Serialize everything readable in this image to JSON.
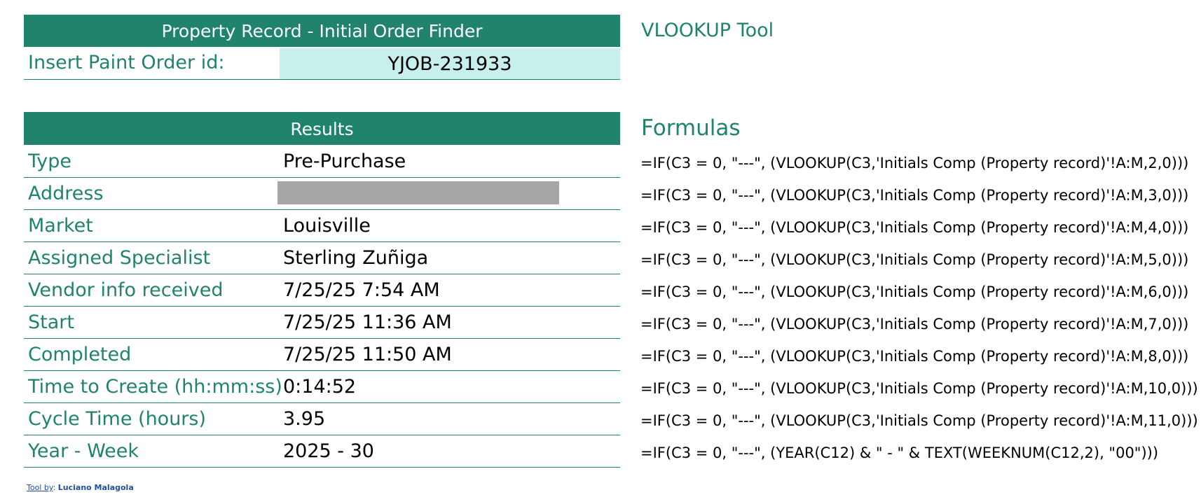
{
  "tool": {
    "title": "Property Record - Initial Order Finder",
    "input_label": "Insert Paint Order id:",
    "input_value": "YJOB-231933",
    "results_header": "Results"
  },
  "results": [
    {
      "label": "Type",
      "value": "Pre-Purchase",
      "redacted": false
    },
    {
      "label": "Address",
      "value": "",
      "redacted": true
    },
    {
      "label": "Market",
      "value": "Louisville",
      "redacted": false
    },
    {
      "label": "Assigned Specialist",
      "value": "Sterling Zuñiga",
      "redacted": false
    },
    {
      "label": "Vendor info received",
      "value": "7/25/25 7:54 AM",
      "redacted": false
    },
    {
      "label": "Start",
      "value": "7/25/25 11:36 AM",
      "redacted": false
    },
    {
      "label": "Completed",
      "value": "7/25/25 11:50 AM",
      "redacted": false
    },
    {
      "label": "Time to Create (hh:mm:ss)",
      "value": "0:14:52",
      "redacted": false
    },
    {
      "label": "Cycle Time (hours)",
      "value": "3.95",
      "redacted": false
    },
    {
      "label": "Year - Week",
      "value": "2025 - 30",
      "redacted": false
    }
  ],
  "side": {
    "vlookup_title": "VLOOKUP Tool",
    "formulas_title": "Formulas",
    "formulas": [
      "=IF(C3 = 0, \"---\", (VLOOKUP(C3,'Initials Comp (Property record)'!A:M,2,0)))",
      "=IF(C3 = 0, \"---\", (VLOOKUP(C3,'Initials Comp (Property record)'!A:M,3,0)))",
      "=IF(C3 = 0, \"---\", (VLOOKUP(C3,'Initials Comp (Property record)'!A:M,4,0)))",
      "=IF(C3 = 0, \"---\", (VLOOKUP(C3,'Initials Comp (Property record)'!A:M,5,0)))",
      "=IF(C3 = 0, \"---\", (VLOOKUP(C3,'Initials Comp (Property record)'!A:M,6,0)))",
      "=IF(C3 = 0, \"---\", (VLOOKUP(C3,'Initials Comp (Property record)'!A:M,7,0)))",
      "=IF(C3 = 0, \"---\", (VLOOKUP(C3,'Initials Comp (Property record)'!A:M,8,0)))",
      "=IF(C3 = 0, \"---\", (VLOOKUP(C3,'Initials Comp (Property record)'!A:M,10,0)))",
      "=IF(C3 = 0, \"---\", (VLOOKUP(C3,'Initials Comp (Property record)'!A:M,11,0)))",
      "=IF(C3 = 0, \"---\", (YEAR(C12) & \" - \" & TEXT(WEEKNUM(C12,2), \"00\")))"
    ]
  },
  "credit": {
    "link_text": "Tool by",
    "separator": ":",
    "author": "Luciano Malagola"
  },
  "colors": {
    "accent": "#1f846b",
    "input_fill": "#c7efec",
    "redaction": "#a6a6a9",
    "credit_link": "#1f4f9c"
  }
}
